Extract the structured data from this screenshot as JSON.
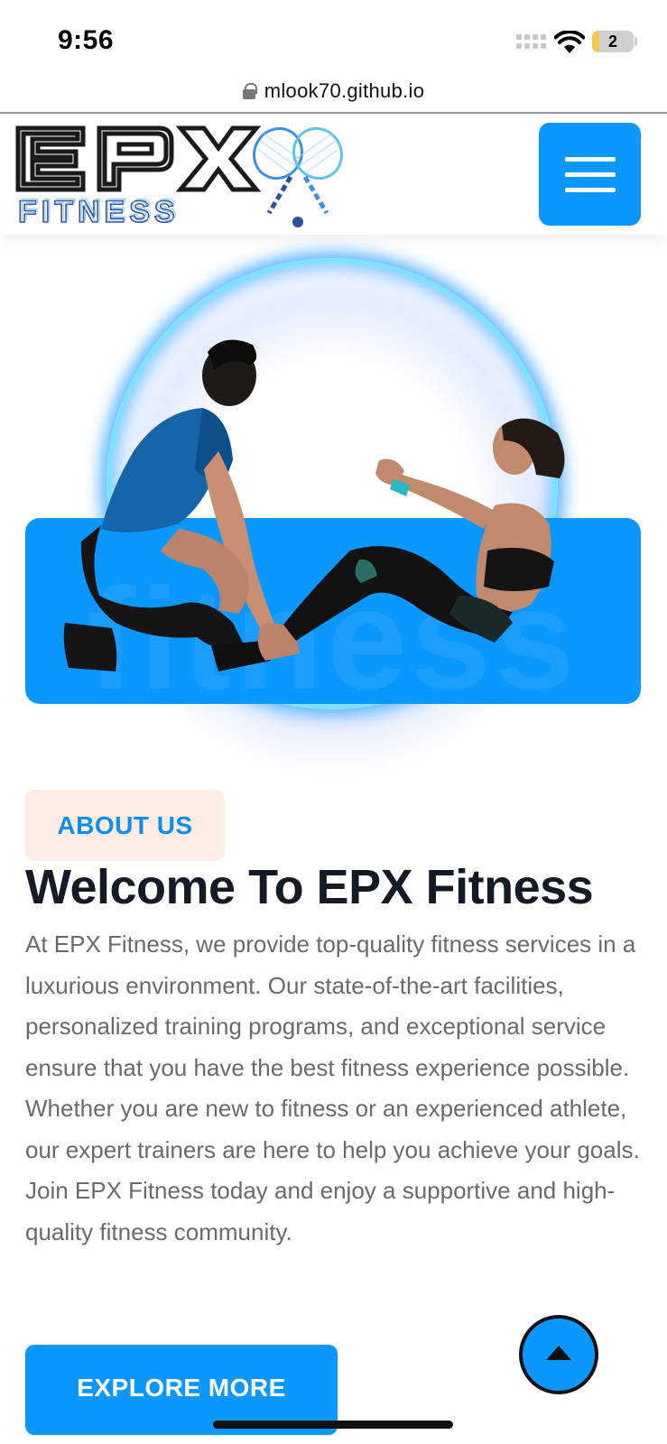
{
  "status_bar": {
    "time": "9:56",
    "battery_level": "2",
    "icons": [
      "cellular-signal-icon",
      "wifi-icon",
      "battery-icon"
    ]
  },
  "browser": {
    "url": "mlook70.github.io",
    "icons": [
      "lock-icon"
    ]
  },
  "header": {
    "logo_icon": "tennis-rackets-icon",
    "menu_icon": "hamburger-menu-icon"
  },
  "hero": {
    "banner_word": "fitness",
    "image": "trainer-and-woman-doing-sit-ups-silhouette"
  },
  "about": {
    "badge": "ABOUT US",
    "title": "Welcome To EPX Fitness",
    "text": "At EPX Fitness, we provide top-quality fitness services in a luxurious environment. Our state-of-the-art facilities, personalized training programs, and exceptional service ensure that you have the best fitness experience possible. Whether you are new to fitness or an experienced athlete, our expert trainers are here to help you achieve your goals. Join EPX Fitness today and enjoy a supportive and high-quality fitness community."
  },
  "cta": {
    "explore_label": "EXPLORE MORE",
    "scroll_top_icon": "arrow-up-icon"
  },
  "colors": {
    "accent": "#0a97ff",
    "badge_bg": "#fdebe6",
    "title": "#141a26",
    "body_text": "#6a6a6a"
  }
}
